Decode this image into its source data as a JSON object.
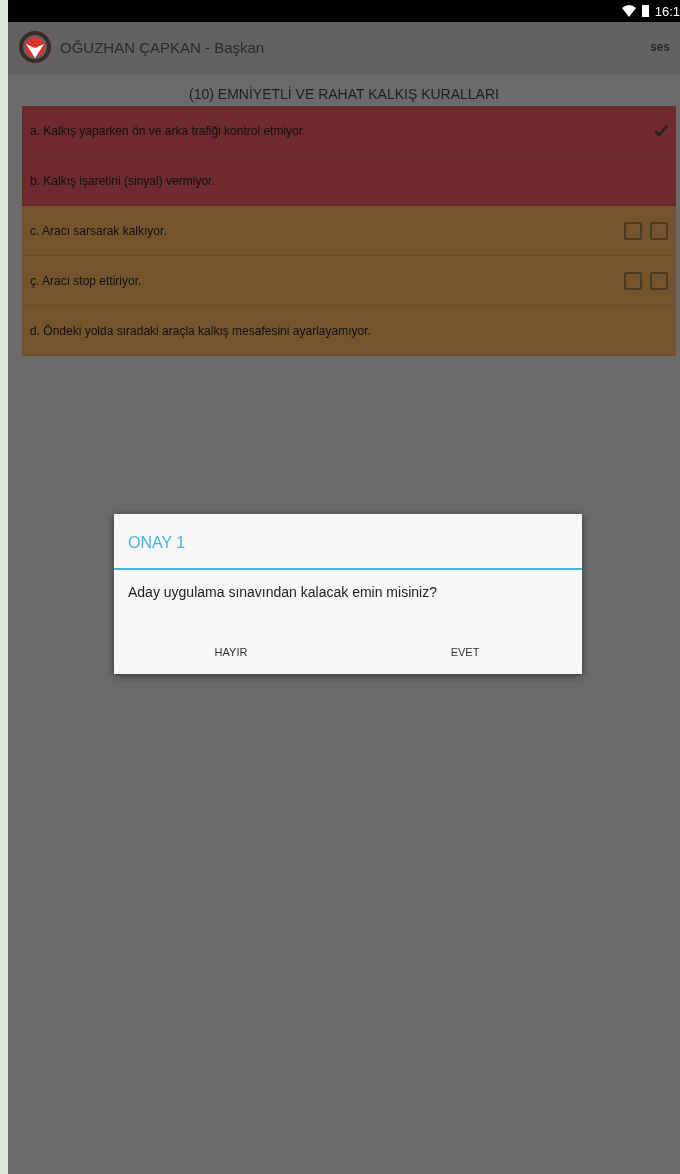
{
  "status_bar": {
    "time": "16:1"
  },
  "app_bar": {
    "title": "OĞUZHAN ÇAPKAN - Başkan",
    "action": "ses"
  },
  "section_title": "(10) EMNİYETLİ VE RAHAT KALKIŞ KURALLARI",
  "rules": [
    {
      "text": "a. Kalkış yaparken ön ve arka trafiği kontrol etmiyor.",
      "color": "#6e2a2e",
      "kind": "mark",
      "checked": true
    },
    {
      "text": "b. Kalkış işaretini (sinyal) vermiyor.",
      "color": "#6e2a2e",
      "kind": "plain"
    },
    {
      "text": "c. Aracı sarsarak kalkıyor.",
      "color": "#74542c",
      "kind": "boxes",
      "checked": false
    },
    {
      "text": "ç. Aracı stop ettiriyor.",
      "color": "#74542c",
      "kind": "boxes",
      "checked": false
    },
    {
      "text": "d. Öndeki yolda sıradaki araçla kalkış mesafesini ayarlayamıyor.",
      "color": "#74542c",
      "kind": "plain"
    }
  ],
  "dialog": {
    "title": "ONAY 1",
    "message": "Aday uygulama sınavından kalacak emin misiniz?",
    "buttons": [
      "HAYIR",
      "EVET"
    ]
  }
}
